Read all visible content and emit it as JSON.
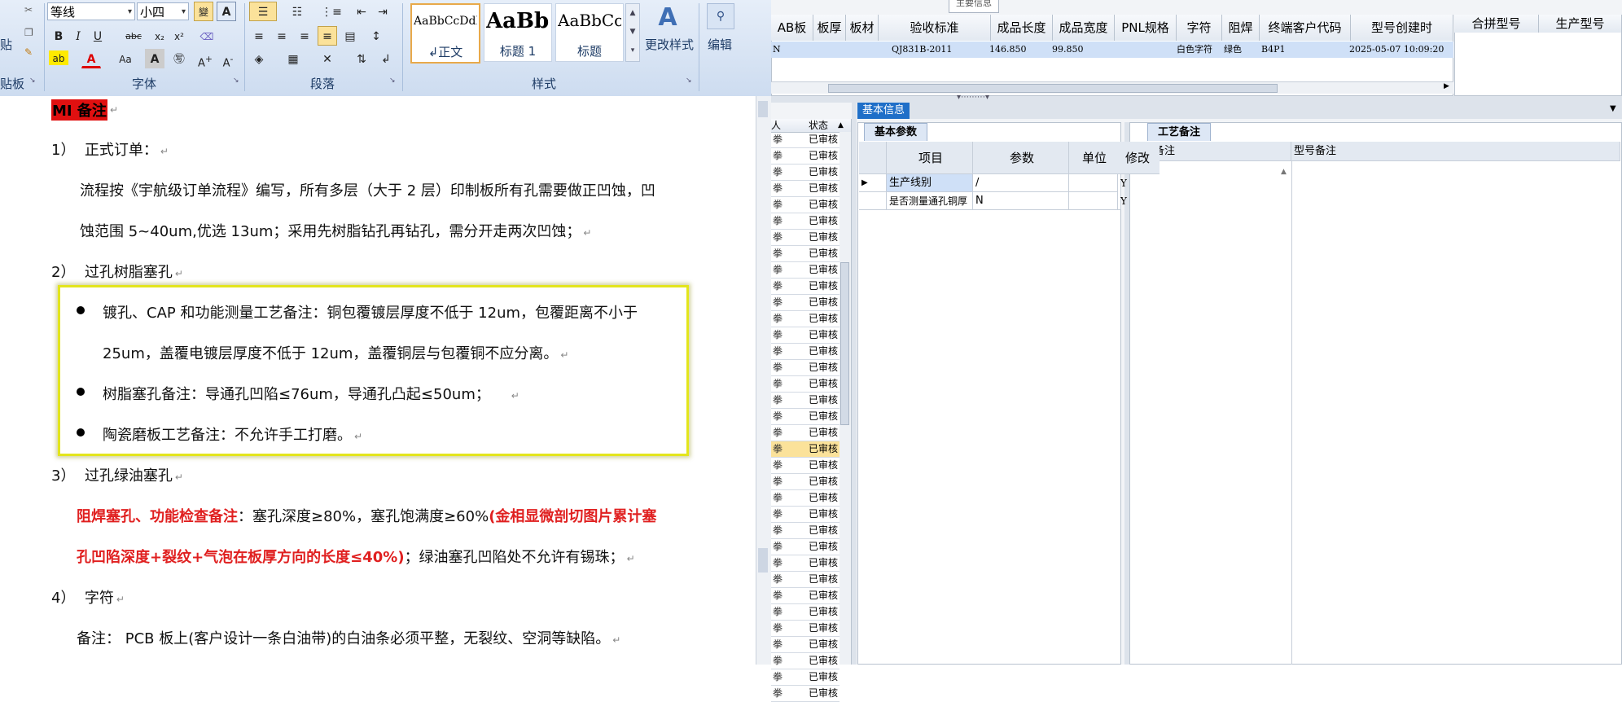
{
  "word": {
    "font_name": "等线",
    "font_size": "小四",
    "groups": {
      "clipboard": "贴板",
      "font": "字体",
      "paragraph": "段落",
      "styles": "样式"
    },
    "clipboard_paste": "贴",
    "styles_gallery": [
      {
        "preview": "AaBbCcDdEe",
        "name": "↲正文"
      },
      {
        "preview": "AaBbC",
        "name": "标题 1"
      },
      {
        "preview": "AaBbCc",
        "name": "标题"
      }
    ],
    "change_styles": "更改样式",
    "edit": "编辑"
  },
  "doc": {
    "heading": "MI 备注",
    "s1_num": "1）",
    "s1_title": "正式订单：",
    "s1_body_1": "流程按《宇航级订单流程》编写，所有多层（大于 2 层）印制板所有孔需要做正凹蚀，凹",
    "s1_body_2": "蚀范围 5~40um,优选 13um；采用先树脂钻孔再钻孔，需分开走两次凹蚀；",
    "s2_num": "2）",
    "s2_title": "过孔树脂塞孔",
    "b1_line1": "镀孔、CAP  和功能测量工艺备注：铜包覆镀层厚度不低于  12um，包覆距离不小于",
    "b1_line2": "25um，盖覆电镀层厚度不低于 12um，盖覆铜层与包覆铜不应分离。",
    "b2": "树脂塞孔备注：导通孔凹陷≤76um，导通孔凸起≤50um；",
    "b3": "陶瓷磨板工艺备注：不允许手工打磨。",
    "s3_num": "3）",
    "s3_title": "过孔绿油塞孔",
    "s3_red_1": "阻焊塞孔、功能检查备注",
    "s3_black_1": "：塞孔深度≥80%，塞孔饱满度≥60%",
    "s3_red_2": "(金相显微剖切图片累计塞",
    "s3_red_3": "孔凹陷深度+裂纹+气泡在板厚方向的长度≤40%)",
    "s3_black_2": "；绿油塞孔凹陷处不允许有锡珠；",
    "s4_num": "4）",
    "s4_title": "字符",
    "s4_body": "备注：  PCB 板上(客户设计一条白油带)的白油条必须平整，无裂纹、空洞等缺陷。"
  },
  "app": {
    "main_info_label": "主要信息",
    "top_headers": [
      "AB板",
      "板厚",
      "板材",
      "验收标准",
      "成品长度",
      "成品宽度",
      "PNL规格",
      "字符",
      "阻焊",
      "终端客户代码",
      "型号创建时"
    ],
    "top_row": [
      "N",
      "",
      "",
      "QJ831B-2011",
      "146.850",
      "99.850",
      "",
      "白色字符",
      "绿色",
      "B4P1",
      "2025-05-07 10:09:20"
    ],
    "right_headers": [
      "合拼型号",
      "生产型号"
    ],
    "list_headers": [
      "人",
      "状态"
    ],
    "status_value": "已审核",
    "status_count": 35,
    "basic_info_tab": "基本信息",
    "basic_params_tab": "基本参数",
    "param_headers": [
      "项目",
      "参数",
      "单位",
      "修改"
    ],
    "param_rows": [
      {
        "item": "生产线别",
        "param": "/",
        "unit": "",
        "mod": "Y"
      },
      {
        "item": "是否测量通孔铜厚",
        "param": "N",
        "unit": "",
        "mod": "Y"
      }
    ],
    "process_tab": "工艺备注",
    "process_headers": [
      "工艺备注",
      "型号备注"
    ]
  },
  "colors": {
    "accent": "#1f6fc8",
    "selected_row": "#cfe0f7",
    "highlight_box": "#e3e51c",
    "red_text": "#e02020"
  }
}
